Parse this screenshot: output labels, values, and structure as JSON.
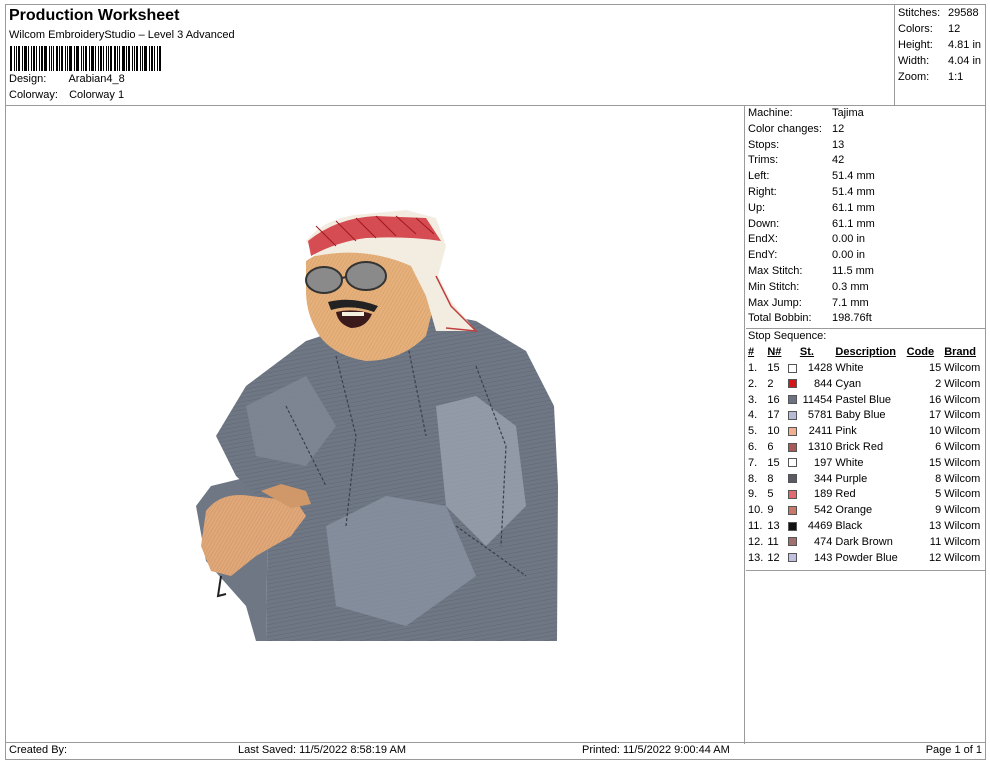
{
  "header": {
    "title": "Production Worksheet",
    "subtitle": "Wilcom EmbroideryStudio – Level 3 Advanced",
    "design_label": "Design:",
    "design_value": "Arabian4_8",
    "colorway_label": "Colorway:",
    "colorway_value": "Colorway 1"
  },
  "summary": [
    {
      "label": "Stitches:",
      "value": "29588"
    },
    {
      "label": "Colors:",
      "value": "12"
    },
    {
      "label": "Height:",
      "value": "4.81 in"
    },
    {
      "label": "Width:",
      "value": "4.04 in"
    },
    {
      "label": "Zoom:",
      "value": "1:1"
    }
  ],
  "machine_info": [
    {
      "label": "Machine:",
      "value": "Tajima"
    },
    {
      "label": "Color changes:",
      "value": "12"
    },
    {
      "label": "Stops:",
      "value": "13"
    },
    {
      "label": "Trims:",
      "value": "42"
    },
    {
      "label": "Left:",
      "value": "51.4 mm"
    },
    {
      "label": "Right:",
      "value": "51.4 mm"
    },
    {
      "label": "Up:",
      "value": "61.1 mm"
    },
    {
      "label": "Down:",
      "value": "61.1 mm"
    },
    {
      "label": "EndX:",
      "value": "0.00 in"
    },
    {
      "label": "EndY:",
      "value": "0.00 in"
    },
    {
      "label": "Max Stitch:",
      "value": "11.5 mm"
    },
    {
      "label": "Min Stitch:",
      "value": "0.3 mm"
    },
    {
      "label": "Max Jump:",
      "value": "7.1 mm"
    },
    {
      "label": "Total Bobbin:",
      "value": "198.76ft"
    }
  ],
  "stop_sequence": {
    "title": "Stop Sequence:",
    "columns": [
      "#",
      "N#",
      "St.",
      "Description",
      "Code",
      "Brand"
    ],
    "rows": [
      {
        "idx": "1.",
        "n": "15",
        "color": "#ffffff",
        "st": "1428",
        "desc": "White",
        "code": "15",
        "brand": "Wilcom"
      },
      {
        "idx": "2.",
        "n": "2",
        "color": "#d7141a",
        "st": "844",
        "desc": "Cyan",
        "code": "2",
        "brand": "Wilcom"
      },
      {
        "idx": "3.",
        "n": "16",
        "color": "#6c7282",
        "st": "11454",
        "desc": "Pastel Blue",
        "code": "16",
        "brand": "Wilcom"
      },
      {
        "idx": "4.",
        "n": "17",
        "color": "#b8bad6",
        "st": "5781",
        "desc": "Baby Blue",
        "code": "17",
        "brand": "Wilcom"
      },
      {
        "idx": "5.",
        "n": "10",
        "color": "#f0b090",
        "st": "2411",
        "desc": "Pink",
        "code": "10",
        "brand": "Wilcom"
      },
      {
        "idx": "6.",
        "n": "6",
        "color": "#a85a58",
        "st": "1310",
        "desc": "Brick Red",
        "code": "6",
        "brand": "Wilcom"
      },
      {
        "idx": "7.",
        "n": "15",
        "color": "#ffffff",
        "st": "197",
        "desc": "White",
        "code": "15",
        "brand": "Wilcom"
      },
      {
        "idx": "8.",
        "n": "8",
        "color": "#5a5a62",
        "st": "344",
        "desc": "Purple",
        "code": "8",
        "brand": "Wilcom"
      },
      {
        "idx": "9.",
        "n": "5",
        "color": "#e06a70",
        "st": "189",
        "desc": "Red",
        "code": "5",
        "brand": "Wilcom"
      },
      {
        "idx": "10.",
        "n": "9",
        "color": "#c87868",
        "st": "542",
        "desc": "Orange",
        "code": "9",
        "brand": "Wilcom"
      },
      {
        "idx": "11.",
        "n": "13",
        "color": "#111111",
        "st": "4469",
        "desc": "Black",
        "code": "13",
        "brand": "Wilcom"
      },
      {
        "idx": "12.",
        "n": "11",
        "color": "#a07070",
        "st": "474",
        "desc": "Dark Brown",
        "code": "11",
        "brand": "Wilcom"
      },
      {
        "idx": "13.",
        "n": "12",
        "color": "#c0c0e0",
        "st": "143",
        "desc": "Powder Blue",
        "code": "12",
        "brand": "Wilcom"
      }
    ]
  },
  "footer": {
    "created_by": "Created By:",
    "last_saved": "Last Saved: 11/5/2022 8:58:19 AM",
    "printed": "Printed: 11/5/2022 9:00:44 AM",
    "page": "Page 1 of 1"
  },
  "colors": {
    "robe": "#6f7785",
    "robe_light": "#9aa2ae",
    "skin": "#e0a878",
    "keffiyeh_red": "#d0303a",
    "border": "#9a9a9a"
  }
}
